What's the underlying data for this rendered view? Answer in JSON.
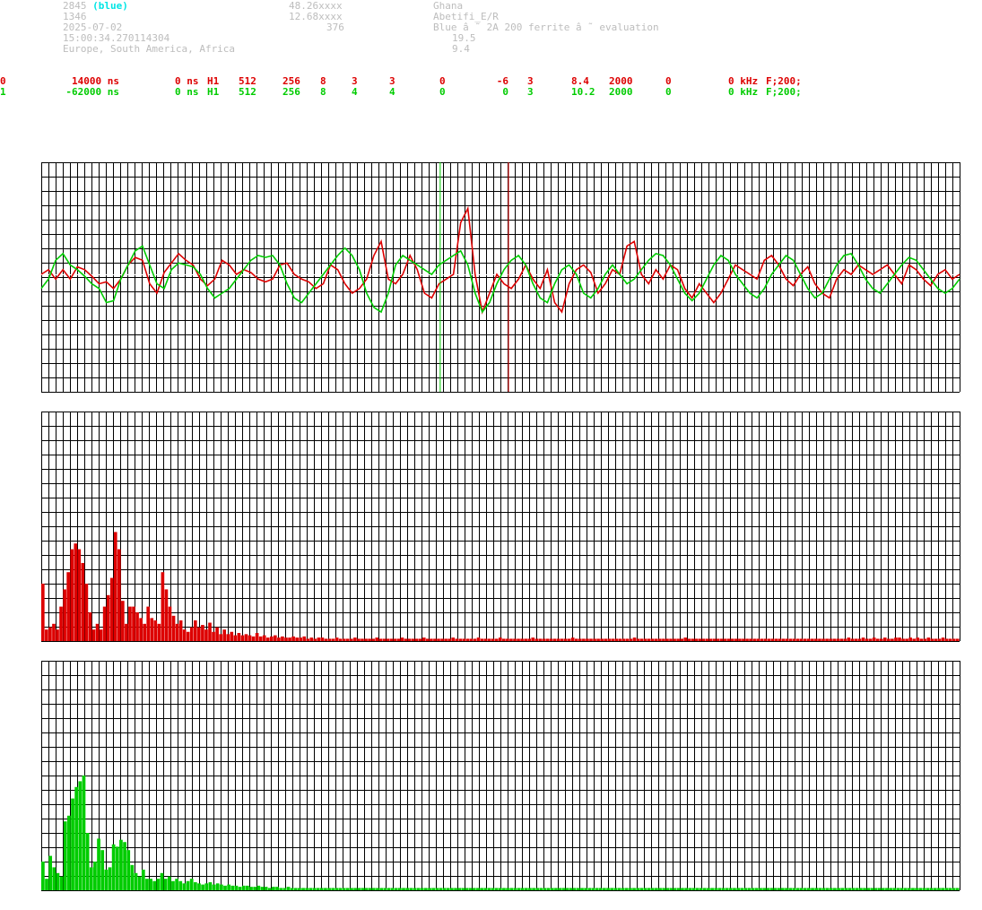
{
  "header": {
    "station_id": "2845",
    "station_color_tag": "(blue)",
    "station_num": "1346",
    "date": "2025-07-02",
    "time": "15:00:34.270114304",
    "region": "Europe, South America, Africa",
    "lat": "48.26xxxx",
    "lon": "12.68xxxx",
    "alt": "376",
    "country": "Ghana",
    "location": "Abetifi_E/R",
    "antenna": "Blue â ˜ 2A 200 ferrite â ˜ evaluation",
    "val_a": "19.5",
    "val_b": "9.4"
  },
  "channels": [
    {
      "idx": "0",
      "offset": "14000 ns",
      "delay": "0 ns",
      "mode": "H1",
      "c1": "512",
      "c2": "256",
      "c3": "8",
      "c4": "3",
      "c5": "3",
      "c6": "0",
      "c7": "-6",
      "c8": "3",
      "c9": "8.4",
      "c10": "2000",
      "c11": "0",
      "freq": "0 kHz",
      "filter": "F;200;",
      "color": "#dd0000"
    },
    {
      "idx": "1",
      "offset": "-62000 ns",
      "delay": "0 ns",
      "mode": "H1",
      "c1": "512",
      "c2": "256",
      "c3": "8",
      "c4": "4",
      "c5": "4",
      "c6": "0",
      "c7": "0",
      "c8": "3",
      "c9": "10.2",
      "c10": "2000",
      "c11": "0",
      "freq": "0 kHz",
      "filter": "F;200;",
      "color": "#00cc00"
    }
  ],
  "colors": {
    "grid": "#000000",
    "red": "#dd0000",
    "green": "#00cc00",
    "white": "#ffffff"
  },
  "chart_data": [
    {
      "type": "line",
      "grid": true,
      "ylim": [
        -1,
        1
      ],
      "xlim": [
        0,
        511
      ],
      "series": [
        {
          "color": "#dd0000",
          "markers": [
            260
          ],
          "values": [
            0.0,
            0.05,
            -0.05,
            0.05,
            -0.05,
            0.08,
            0.05,
            -0.02,
            -0.1,
            -0.08,
            -0.15,
            -0.05,
            0.1,
            0.18,
            0.15,
            -0.1,
            -0.2,
            0.02,
            0.12,
            0.22,
            0.15,
            0.1,
            -0.05,
            -0.12,
            -0.05,
            0.15,
            0.1,
            0.0,
            0.05,
            0.02,
            -0.05,
            -0.08,
            -0.05,
            0.1,
            0.12,
            0.0,
            -0.05,
            -0.08,
            -0.15,
            -0.1,
            0.1,
            0.05,
            -0.1,
            -0.2,
            -0.15,
            -0.05,
            0.2,
            0.35,
            -0.05,
            -0.1,
            0.0,
            0.2,
            0.05,
            -0.2,
            -0.25,
            -0.1,
            -0.05,
            0.0,
            0.55,
            0.7,
            0.0,
            -0.4,
            -0.2,
            0.0,
            -0.1,
            -0.15,
            -0.05,
            0.1,
            -0.05,
            -0.15,
            0.05,
            -0.3,
            -0.4,
            -0.1,
            0.05,
            0.1,
            0.02,
            -0.2,
            -0.1,
            0.05,
            0.0,
            0.3,
            0.35,
            0.0,
            -0.1,
            0.05,
            -0.05,
            0.1,
            0.05,
            -0.15,
            -0.25,
            -0.1,
            -0.2,
            -0.3,
            -0.2,
            -0.05,
            0.1,
            0.05,
            0.0,
            -0.05,
            0.15,
            0.2,
            0.1,
            -0.05,
            -0.12,
            0.0,
            0.08,
            -0.1,
            -0.2,
            -0.25,
            -0.05,
            0.05,
            0.0,
            0.1,
            0.05,
            0.0,
            0.05,
            0.1,
            0.0,
            -0.1,
            0.1,
            0.05,
            -0.05,
            -0.12,
            0.0,
            0.05,
            -0.05,
            0.0
          ]
        },
        {
          "color": "#00cc00",
          "markers": [
            222
          ],
          "values": [
            -0.15,
            -0.05,
            0.15,
            0.22,
            0.1,
            0.05,
            -0.02,
            -0.1,
            -0.15,
            -0.3,
            -0.28,
            -0.05,
            0.1,
            0.25,
            0.3,
            0.1,
            -0.1,
            -0.15,
            0.05,
            0.12,
            0.1,
            0.08,
            0.0,
            -0.15,
            -0.25,
            -0.2,
            -0.15,
            -0.05,
            0.05,
            0.15,
            0.2,
            0.18,
            0.2,
            0.1,
            -0.1,
            -0.25,
            -0.3,
            -0.2,
            -0.1,
            0.0,
            0.1,
            0.2,
            0.28,
            0.2,
            0.05,
            -0.2,
            -0.35,
            -0.4,
            -0.2,
            0.1,
            0.2,
            0.15,
            0.1,
            0.05,
            0.0,
            0.1,
            0.15,
            0.2,
            0.25,
            0.1,
            -0.2,
            -0.4,
            -0.3,
            -0.1,
            0.05,
            0.15,
            0.2,
            0.1,
            -0.1,
            -0.25,
            -0.3,
            -0.1,
            0.05,
            0.1,
            0.0,
            -0.2,
            -0.25,
            -0.15,
            0.0,
            0.1,
            0.0,
            -0.1,
            -0.05,
            0.05,
            0.15,
            0.22,
            0.2,
            0.1,
            -0.05,
            -0.2,
            -0.28,
            -0.2,
            -0.05,
            0.1,
            0.2,
            0.15,
            0.0,
            -0.1,
            -0.2,
            -0.25,
            -0.15,
            0.0,
            0.1,
            0.2,
            0.15,
            0.0,
            -0.15,
            -0.25,
            -0.2,
            -0.05,
            0.1,
            0.2,
            0.22,
            0.1,
            -0.05,
            -0.15,
            -0.2,
            -0.1,
            0.0,
            0.1,
            0.18,
            0.15,
            0.05,
            -0.05,
            -0.15,
            -0.2,
            -0.15,
            -0.05
          ]
        }
      ]
    },
    {
      "type": "bar",
      "grid": true,
      "ylim": [
        0,
        1
      ],
      "color": "#dd0000",
      "values": [
        0.5,
        0.1,
        0.12,
        0.15,
        0.1,
        0.3,
        0.45,
        0.6,
        0.8,
        0.85,
        0.8,
        0.68,
        0.5,
        0.25,
        0.1,
        0.15,
        0.1,
        0.3,
        0.4,
        0.55,
        0.95,
        0.8,
        0.35,
        0.15,
        0.3,
        0.3,
        0.25,
        0.2,
        0.15,
        0.3,
        0.2,
        0.18,
        0.15,
        0.6,
        0.45,
        0.3,
        0.22,
        0.15,
        0.18,
        0.1,
        0.08,
        0.12,
        0.18,
        0.12,
        0.14,
        0.1,
        0.16,
        0.08,
        0.12,
        0.06,
        0.1,
        0.06,
        0.08,
        0.05,
        0.07,
        0.05,
        0.06,
        0.05,
        0.04,
        0.07,
        0.04,
        0.05,
        0.03,
        0.04,
        0.05,
        0.03,
        0.04,
        0.03,
        0.03,
        0.04,
        0.03,
        0.03,
        0.04,
        0.02,
        0.03,
        0.02,
        0.03,
        0.03,
        0.02,
        0.02,
        0.02,
        0.03,
        0.02,
        0.02,
        0.02,
        0.02,
        0.03,
        0.02,
        0.02,
        0.02,
        0.02,
        0.02,
        0.03,
        0.02,
        0.02,
        0.02,
        0.02,
        0.02,
        0.02,
        0.03,
        0.02,
        0.02,
        0.02,
        0.02,
        0.02,
        0.03,
        0.02,
        0.02,
        0.02,
        0.02,
        0.02,
        0.02,
        0.02,
        0.03,
        0.02,
        0.02,
        0.02,
        0.02,
        0.02,
        0.02,
        0.03,
        0.02,
        0.02,
        0.02,
        0.02,
        0.02,
        0.03,
        0.02,
        0.02,
        0.02,
        0.02,
        0.02,
        0.02,
        0.02,
        0.02,
        0.03,
        0.02,
        0.02,
        0.02,
        0.02,
        0.02,
        0.02,
        0.02,
        0.02,
        0.02,
        0.02,
        0.03,
        0.02,
        0.02,
        0.02,
        0.02,
        0.02,
        0.02,
        0.02,
        0.02,
        0.02,
        0.02,
        0.02,
        0.02,
        0.02,
        0.02,
        0.02,
        0.02,
        0.03,
        0.02,
        0.02,
        0.02,
        0.02,
        0.02,
        0.02,
        0.02,
        0.02,
        0.02,
        0.02,
        0.02,
        0.02,
        0.02,
        0.03,
        0.02,
        0.02,
        0.02,
        0.02,
        0.02,
        0.02,
        0.02,
        0.02,
        0.02,
        0.02,
        0.02,
        0.02,
        0.02,
        0.02,
        0.02,
        0.02,
        0.02,
        0.02,
        0.02,
        0.02,
        0.02,
        0.02,
        0.02,
        0.02,
        0.02,
        0.02,
        0.02,
        0.02,
        0.02,
        0.02,
        0.02,
        0.02,
        0.02,
        0.02,
        0.02,
        0.02,
        0.02,
        0.02,
        0.02,
        0.02,
        0.02,
        0.02,
        0.02,
        0.02,
        0.03,
        0.02,
        0.02,
        0.02,
        0.03,
        0.02,
        0.02,
        0.03,
        0.02,
        0.02,
        0.03,
        0.02,
        0.02,
        0.03,
        0.03,
        0.02,
        0.02,
        0.03,
        0.02,
        0.03,
        0.02,
        0.02,
        0.03,
        0.02,
        0.02,
        0.02,
        0.03,
        0.02,
        0.02,
        0.02,
        0.02
      ]
    },
    {
      "type": "bar",
      "grid": true,
      "ylim": [
        0,
        1
      ],
      "color": "#00cc00",
      "values": [
        0.25,
        0.1,
        0.3,
        0.2,
        0.15,
        0.12,
        0.6,
        0.65,
        0.8,
        0.9,
        0.95,
        1.0,
        0.5,
        0.2,
        0.25,
        0.45,
        0.35,
        0.18,
        0.2,
        0.4,
        0.38,
        0.44,
        0.42,
        0.35,
        0.22,
        0.15,
        0.12,
        0.18,
        0.1,
        0.1,
        0.08,
        0.1,
        0.15,
        0.1,
        0.12,
        0.08,
        0.1,
        0.08,
        0.06,
        0.08,
        0.1,
        0.07,
        0.06,
        0.05,
        0.06,
        0.07,
        0.05,
        0.06,
        0.05,
        0.04,
        0.05,
        0.04,
        0.04,
        0.03,
        0.04,
        0.04,
        0.03,
        0.03,
        0.04,
        0.03,
        0.03,
        0.02,
        0.03,
        0.03,
        0.02,
        0.02,
        0.03,
        0.02,
        0.02,
        0.02,
        0.02,
        0.02,
        0.02,
        0.02,
        0.02,
        0.02,
        0.02,
        0.02,
        0.02,
        0.02,
        0.02,
        0.02,
        0.02,
        0.02,
        0.02,
        0.02,
        0.02,
        0.02,
        0.02,
        0.02,
        0.02,
        0.02,
        0.02,
        0.02,
        0.02,
        0.02,
        0.02,
        0.02,
        0.02,
        0.02,
        0.02,
        0.02,
        0.02,
        0.02,
        0.02,
        0.02,
        0.02,
        0.02,
        0.02,
        0.02,
        0.02,
        0.02,
        0.02,
        0.02,
        0.02,
        0.02,
        0.02,
        0.02,
        0.02,
        0.02,
        0.02,
        0.02,
        0.02,
        0.02,
        0.02,
        0.02,
        0.02,
        0.02,
        0.02,
        0.02,
        0.02,
        0.02,
        0.02,
        0.02,
        0.02,
        0.02,
        0.02,
        0.02,
        0.02,
        0.02,
        0.02,
        0.02,
        0.02,
        0.02,
        0.02,
        0.02,
        0.02,
        0.02,
        0.02,
        0.02,
        0.02,
        0.02,
        0.02,
        0.02,
        0.02,
        0.02,
        0.02,
        0.02,
        0.02,
        0.02,
        0.02,
        0.02,
        0.02,
        0.02,
        0.02,
        0.02,
        0.02,
        0.02,
        0.02,
        0.02,
        0.02,
        0.02,
        0.02,
        0.02,
        0.02,
        0.02,
        0.02,
        0.02,
        0.02,
        0.02,
        0.02,
        0.02,
        0.02,
        0.02,
        0.02,
        0.02,
        0.02,
        0.02,
        0.02,
        0.02,
        0.02,
        0.02,
        0.02,
        0.02,
        0.02,
        0.02,
        0.02,
        0.02,
        0.02,
        0.02,
        0.02,
        0.02,
        0.02,
        0.02,
        0.02,
        0.02,
        0.02,
        0.02,
        0.02,
        0.02,
        0.02,
        0.02,
        0.02,
        0.02,
        0.02,
        0.02,
        0.02,
        0.02,
        0.02,
        0.02,
        0.02,
        0.02,
        0.02,
        0.02,
        0.02,
        0.02,
        0.02,
        0.02,
        0.02,
        0.02,
        0.02,
        0.02,
        0.02,
        0.02,
        0.02,
        0.02,
        0.02,
        0.02,
        0.02,
        0.02,
        0.02,
        0.02,
        0.02,
        0.02,
        0.02,
        0.02,
        0.02
      ]
    }
  ]
}
